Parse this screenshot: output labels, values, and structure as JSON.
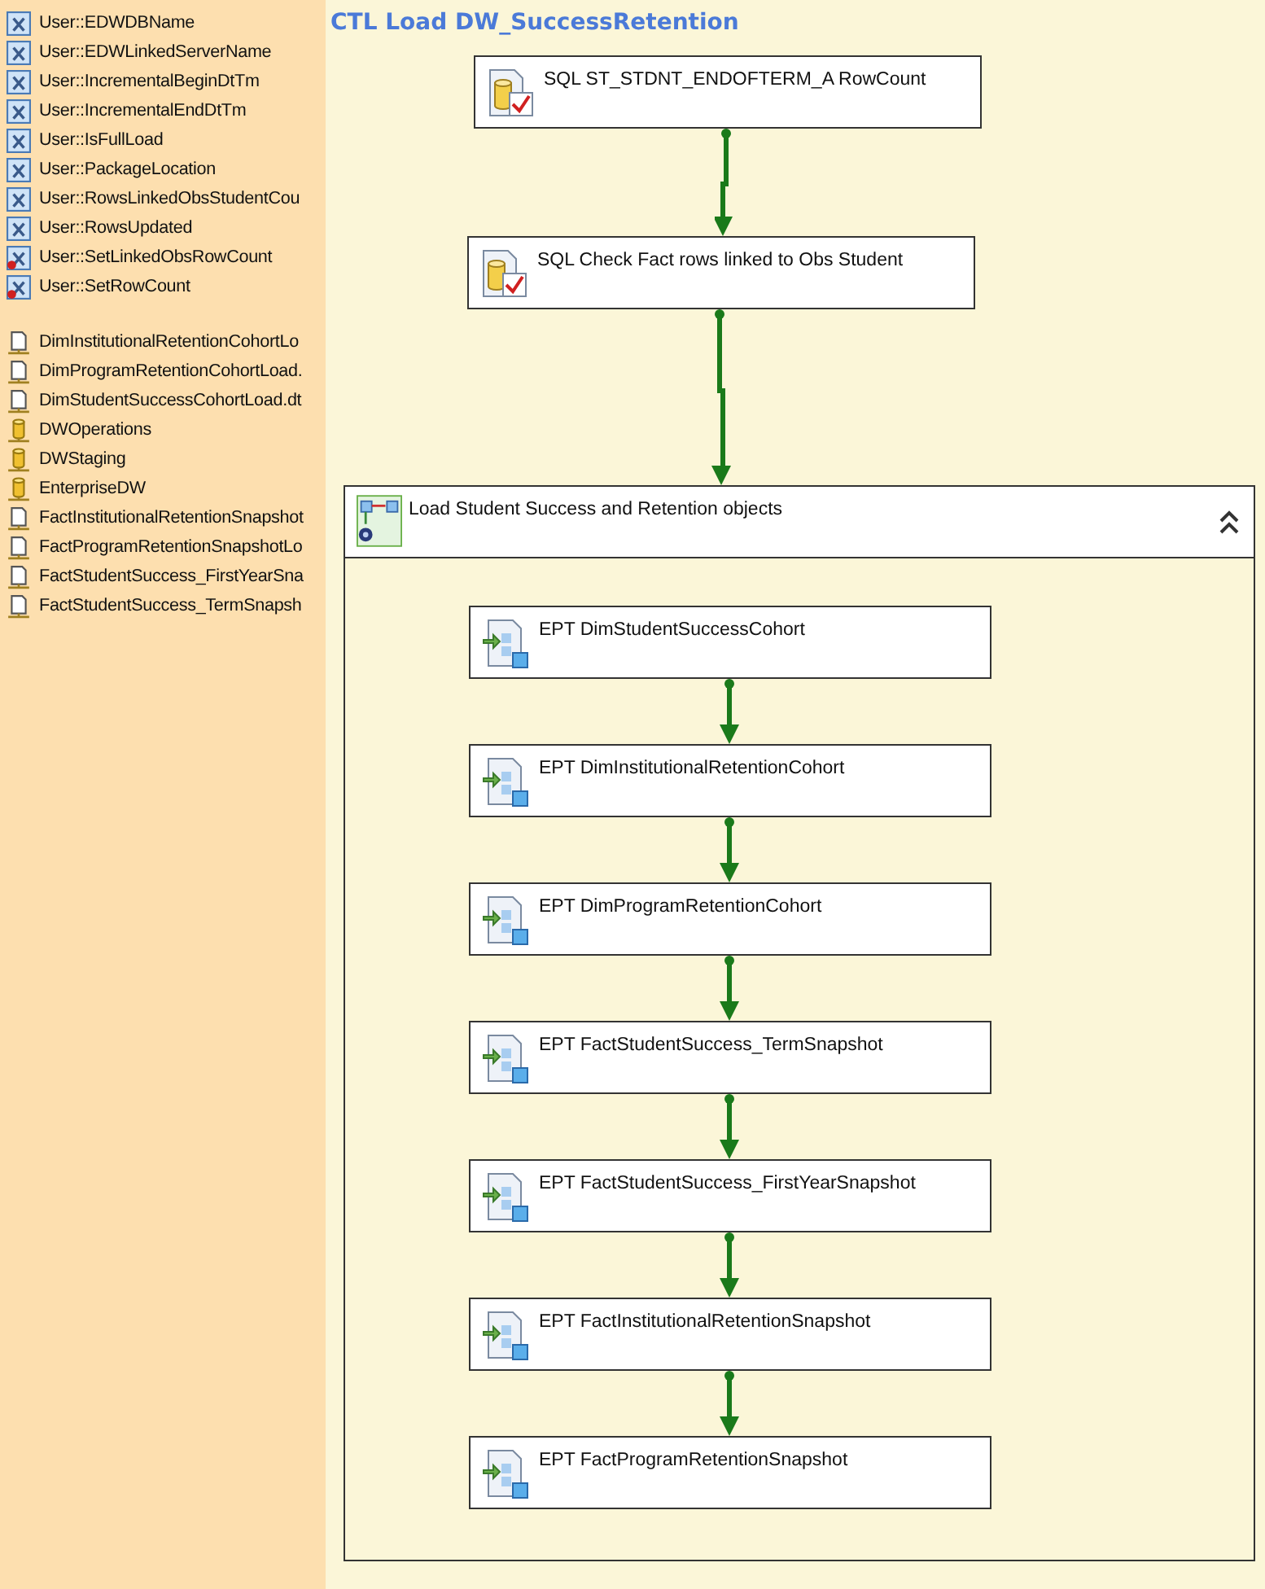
{
  "variables": [
    {
      "name": "User::EDWDBName",
      "kind": "plain"
    },
    {
      "name": "User::EDWLinkedServerName",
      "kind": "plain"
    },
    {
      "name": "User::IncrementalBeginDtTm",
      "kind": "plain"
    },
    {
      "name": "User::IncrementalEndDtTm",
      "kind": "plain"
    },
    {
      "name": "User::IsFullLoad",
      "kind": "plain"
    },
    {
      "name": "User::PackageLocation",
      "kind": "plain"
    },
    {
      "name": "User::RowsLinkedObsStudentCou",
      "kind": "plain"
    },
    {
      "name": "User::RowsUpdated",
      "kind": "plain"
    },
    {
      "name": "User::SetLinkedObsRowCount",
      "kind": "expression"
    },
    {
      "name": "User::SetRowCount",
      "kind": "expression"
    }
  ],
  "connections": [
    {
      "name": "DimInstitutionalRetentionCohortLo",
      "kind": "file"
    },
    {
      "name": "DimProgramRetentionCohortLoad.",
      "kind": "file"
    },
    {
      "name": "DimStudentSuccessCohortLoad.dt",
      "kind": "file"
    },
    {
      "name": "DWOperations",
      "kind": "database"
    },
    {
      "name": "DWStaging",
      "kind": "database"
    },
    {
      "name": "EnterpriseDW",
      "kind": "database"
    },
    {
      "name": "FactInstitutionalRetentionSnapshot",
      "kind": "file"
    },
    {
      "name": "FactProgramRetentionSnapshotLo",
      "kind": "file"
    },
    {
      "name": "FactStudentSuccess_FirstYearSna",
      "kind": "file"
    },
    {
      "name": "FactStudentSuccess_TermSnapsh",
      "kind": "file"
    }
  ],
  "title": "CTL Load DW_SuccessRetention",
  "tasks": [
    {
      "label": "SQL ST_STDNT_ENDOFTERM_A RowCount",
      "kind": "sql"
    },
    {
      "label": "SQL Check Fact rows linked to Obs Student",
      "kind": "sql"
    }
  ],
  "container": {
    "label": "Load Student Success and Retention objects",
    "expanded": true,
    "tasks": [
      {
        "label": "EPT DimStudentSuccessCohort",
        "kind": "ept"
      },
      {
        "label": "EPT DimInstitutionalRetentionCohort",
        "kind": "ept"
      },
      {
        "label": "EPT DimProgramRetentionCohort",
        "kind": "ept"
      },
      {
        "label": "EPT FactStudentSuccess_TermSnapshot",
        "kind": "ept"
      },
      {
        "label": "EPT FactStudentSuccess_FirstYearSnapshot",
        "kind": "ept"
      },
      {
        "label": "EPT FactInstitutionalRetentionSnapshot",
        "kind": "ept"
      },
      {
        "label": "EPT FactProgramRetentionSnapshot",
        "kind": "ept"
      }
    ]
  }
}
